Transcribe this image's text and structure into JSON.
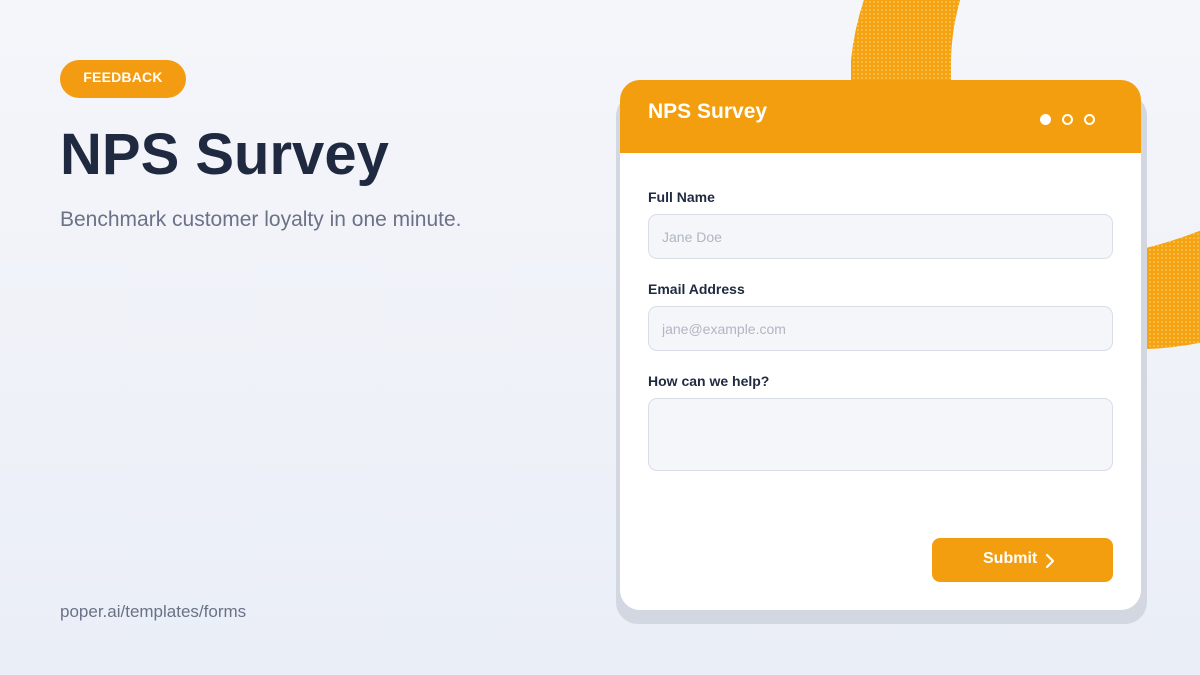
{
  "badge": {
    "label": "FEEDBACK"
  },
  "hero": {
    "title": "NPS Survey",
    "subtitle": "Benchmark customer loyalty in one minute."
  },
  "footer": {
    "link": "poper.ai/templates/forms"
  },
  "form": {
    "title": "NPS Survey",
    "step_indicator": {
      "count": 3,
      "active": 1
    },
    "fields": [
      {
        "label": "Full Name",
        "placeholder": "Jane Doe",
        "value": ""
      },
      {
        "label": "Email Address",
        "placeholder": "jane@example.com",
        "value": ""
      },
      {
        "label": "How can we help?",
        "placeholder": "",
        "value": ""
      }
    ],
    "submit_label": "Submit",
    "submit_icon": "chevron-right-icon"
  },
  "colors": {
    "accent": "#F39E0E",
    "heading": "#1F2940",
    "muted_text": "#6B7287",
    "input_background": "#F5F6FA",
    "input_border": "#D9DDE8"
  }
}
